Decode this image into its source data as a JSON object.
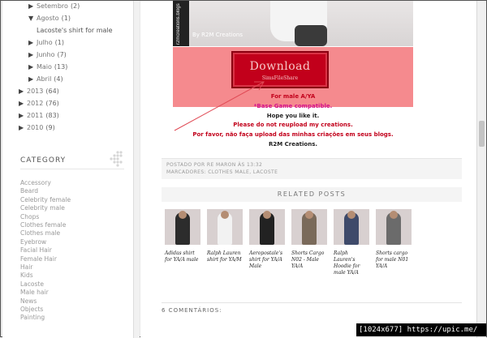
{
  "sidebar": {
    "archive": [
      {
        "label": "Setembro",
        "count": "(2)",
        "state": "collapsed",
        "level": 2
      },
      {
        "label": "Agosto",
        "count": "(1)",
        "state": "expanded",
        "level": 2
      },
      {
        "label": "Lacoste's shirt for male",
        "count": "",
        "state": "post",
        "level": 3
      },
      {
        "label": "Julho",
        "count": "(1)",
        "state": "collapsed",
        "level": 2
      },
      {
        "label": "Junho",
        "count": "(7)",
        "state": "collapsed",
        "level": 2
      },
      {
        "label": "Maio",
        "count": "(13)",
        "state": "collapsed",
        "level": 2
      },
      {
        "label": "Abril",
        "count": "(4)",
        "state": "collapsed",
        "level": 2
      },
      {
        "label": "2013",
        "count": "(64)",
        "state": "collapsed",
        "level": 1
      },
      {
        "label": "2012",
        "count": "(76)",
        "state": "collapsed",
        "level": 1
      },
      {
        "label": "2011",
        "count": "(83)",
        "state": "collapsed",
        "level": 1
      },
      {
        "label": "2010",
        "count": "(9)",
        "state": "collapsed",
        "level": 1
      }
    ],
    "category_title": "CATEGORY",
    "categories": [
      "Accessory",
      "Beard",
      "Celebrity female",
      "Celebrity male",
      "Chops",
      "Clothes female",
      "Clothes male",
      "Eyebrow",
      "Facial Hair",
      "Female Hair",
      "Hair",
      "Kids",
      "Lacoste",
      "Male hair",
      "News",
      "Objects",
      "Painting"
    ]
  },
  "post": {
    "photo_credit": "By R2M Creations",
    "vertical_text": "r2mcreations.blogs",
    "download_label": "Download",
    "download_sub": "SimsFileShare",
    "info_lines": [
      {
        "text": "For male A/YA",
        "color": "#c2001b"
      },
      {
        "text": "*Base Game compatible.",
        "color": "#d4148c"
      },
      {
        "text": "Hope you like it.",
        "color": "#222222"
      },
      {
        "text": "Please do not reupload my creations.",
        "color": "#c2001b"
      },
      {
        "text": "Por favor, não faça upload das minhas criações em seus blogs.",
        "color": "#c2001b"
      },
      {
        "text": "R2M Creations.",
        "color": "#222222"
      }
    ],
    "posted_by": "POSTADO POR RE MARON ÀS 13:32",
    "labels": "MARCADORES: CLOTHES MALE, LACOSTE"
  },
  "related": {
    "title": "RELATED POSTS",
    "items": [
      {
        "caption": "Adidas shirt for YA/A male",
        "shirt": "#2c2c2c"
      },
      {
        "caption": "Ralph Lauren shirt for YA/M",
        "shirt": "#f2f2f2"
      },
      {
        "caption": "Aeropostale's shirt for YA/A Male",
        "shirt": "#222222"
      },
      {
        "caption": "Shorts Cargo N02 - Male YA/A",
        "shirt": "#7a6a5a"
      },
      {
        "caption": "Ralph Lauren's Hoodie for male YA/A",
        "shirt": "#3e4a6a"
      },
      {
        "caption": "Shorts cargo for male N01 YA/A",
        "shirt": "#6b6b6b"
      }
    ]
  },
  "comments_label": "6 COMENTÁRIOS:",
  "watermark": "[1024x677] https://upic.me/"
}
